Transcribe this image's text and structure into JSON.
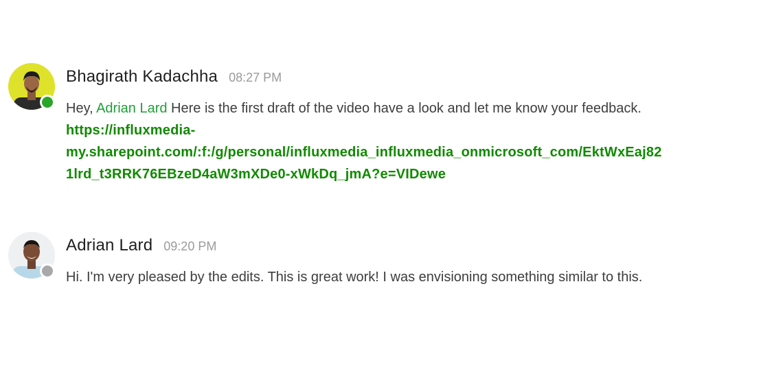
{
  "messages": [
    {
      "author": "Bhagirath Kadachha",
      "time": "08:27 PM",
      "status": "online",
      "text_before": "Hey, ",
      "mention": "Adrian Lard",
      "text_after": " Here is the first draft of the video have a look and let me know your feedback.",
      "link_line1": "https://influxmedia-",
      "link_line2": "my.sharepoint.com/:f:/g/personal/influxmedia_influxmedia_onmicrosoft_com/EktWxEaj82",
      "link_line3": "1lrd_t3RRK76EBzeD4aW3mXDe0-xWkDq_jmA?e=VIDewe"
    },
    {
      "author": "Adrian Lard",
      "time": "09:20 PM",
      "status": "offline",
      "text": "Hi. I'm very pleased by the edits. This is great work! I was envisioning something similar to this."
    }
  ],
  "colors": {
    "online": "#2aa52a",
    "offline": "#a9a9a9",
    "mention": "#1e9f37",
    "link": "#108a00"
  }
}
